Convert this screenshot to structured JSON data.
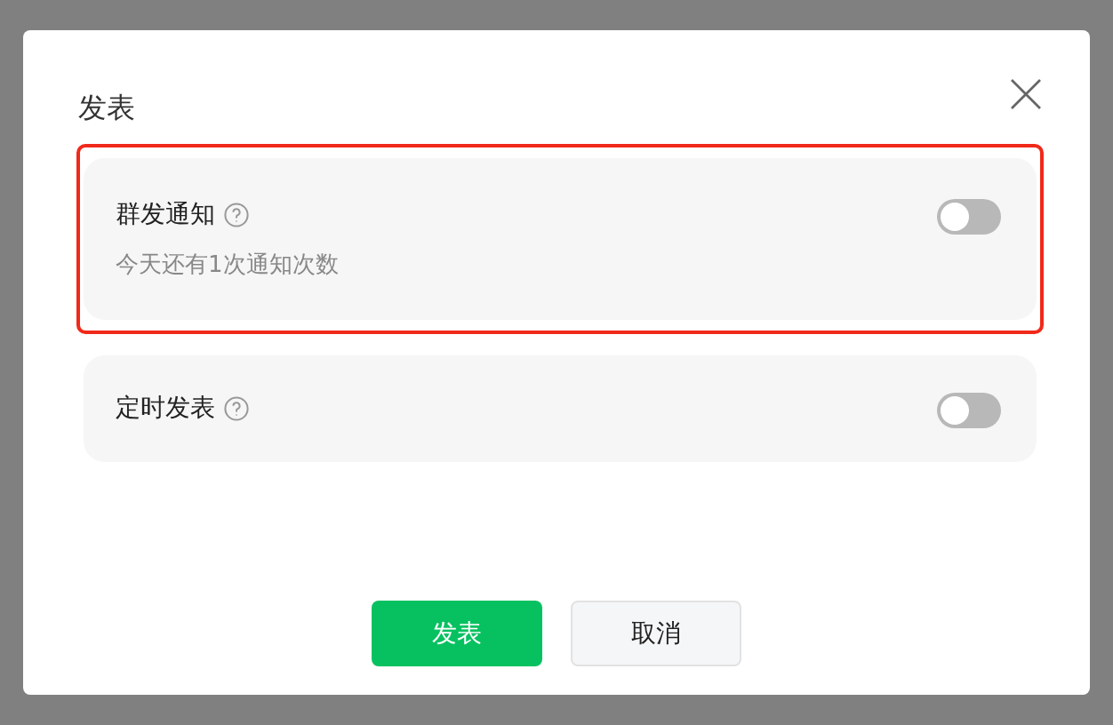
{
  "dialog": {
    "title": "发表"
  },
  "options": [
    {
      "label": "群发通知",
      "note": "今天还有1次通知次数",
      "on": false,
      "highlighted": true
    },
    {
      "label": "定时发表",
      "on": false,
      "highlighted": false
    }
  ],
  "buttons": [
    {
      "label": "发表",
      "kind": "primary"
    },
    {
      "label": "取消",
      "kind": "secondary"
    }
  ]
}
